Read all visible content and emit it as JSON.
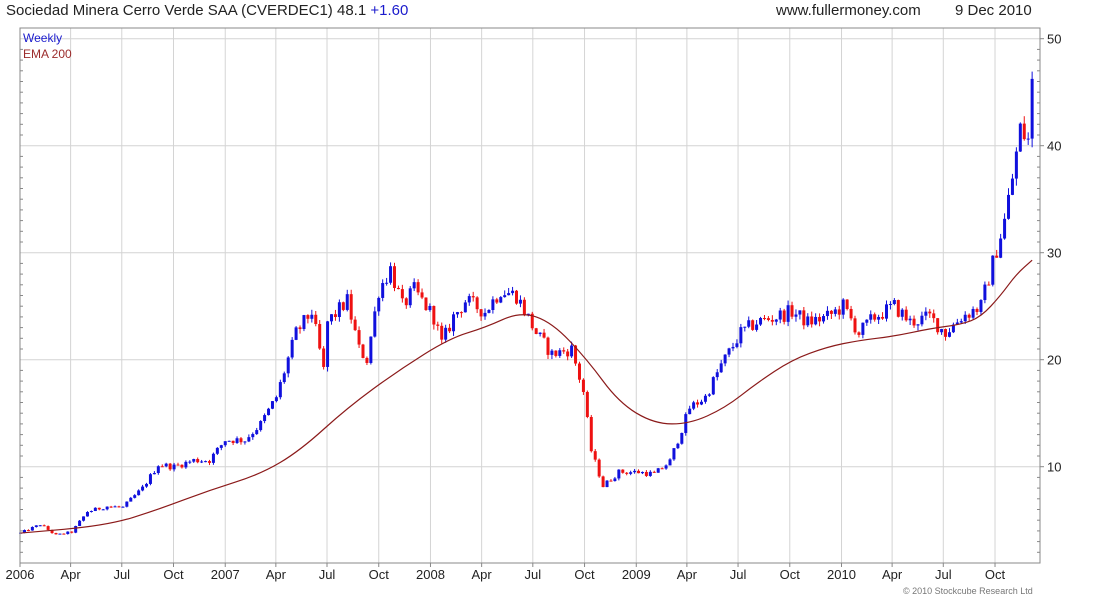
{
  "header": {
    "title": "Sociedad Minera Cerro Verde SAA (CVERDEC1) 48.1",
    "change": "+1.60",
    "site": "www.fullermoney.com",
    "date": "9 Dec 2010"
  },
  "legend": {
    "weekly": "Weekly",
    "ema": "EMA 200"
  },
  "footer": {
    "copyright": "© 2010 Stockcube Research Ltd"
  },
  "colors": {
    "up": "#1010dd",
    "down": "#ee1111",
    "ema": "#8b1a1a",
    "grid": "#d4d4d4",
    "frame": "#888888"
  },
  "chart_data": {
    "type": "candlestick",
    "title": "Sociedad Minera Cerro Verde SAA (CVERDEC1) 48.1 +1.60",
    "frequency": "Weekly",
    "ylim": [
      1,
      51
    ],
    "y_ticks": [
      10,
      20,
      30,
      40,
      50
    ],
    "x_tick_labels": [
      "2006",
      "Apr",
      "Jul",
      "Oct",
      "2007",
      "Apr",
      "Jul",
      "Oct",
      "2008",
      "Apr",
      "Jul",
      "Oct",
      "2009",
      "Apr",
      "Jul",
      "Oct",
      "2010",
      "Apr",
      "Jul",
      "Oct"
    ],
    "grid": true,
    "price_anchors": [
      [
        "2006-01-02",
        3.8
      ],
      [
        "2006-02-06",
        4.6
      ],
      [
        "2006-03-06",
        3.6
      ],
      [
        "2006-04-03",
        3.9
      ],
      [
        "2006-05-01",
        5.8
      ],
      [
        "2006-06-05",
        6.3
      ],
      [
        "2006-07-03",
        6.2
      ],
      [
        "2006-08-07",
        8.0
      ],
      [
        "2006-09-04",
        10.2
      ],
      [
        "2006-10-02",
        10.0
      ],
      [
        "2006-11-06",
        10.6
      ],
      [
        "2006-12-04",
        10.6
      ],
      [
        "2007-01-01",
        12.5
      ],
      [
        "2007-02-05",
        12.5
      ],
      [
        "2007-03-05",
        14.0
      ],
      [
        "2007-04-02",
        16.5
      ],
      [
        "2007-05-07",
        22.5
      ],
      [
        "2007-06-04",
        24.5
      ],
      [
        "2007-06-25",
        19.0
      ],
      [
        "2007-07-02",
        23.5
      ],
      [
        "2007-08-06",
        25.5
      ],
      [
        "2007-08-27",
        21.0
      ],
      [
        "2007-09-10",
        20.0
      ],
      [
        "2007-10-01",
        26.5
      ],
      [
        "2007-10-22",
        28.5
      ],
      [
        "2007-11-12",
        25.0
      ],
      [
        "2007-12-03",
        26.5
      ],
      [
        "2008-01-07",
        24.0
      ],
      [
        "2008-01-21",
        21.5
      ],
      [
        "2008-02-11",
        24.0
      ],
      [
        "2008-03-03",
        25.5
      ],
      [
        "2008-04-07",
        24.5
      ],
      [
        "2008-05-05",
        26.5
      ],
      [
        "2008-06-02",
        26.0
      ],
      [
        "2008-07-07",
        22.5
      ],
      [
        "2008-08-04",
        20.5
      ],
      [
        "2008-09-08",
        21.0
      ],
      [
        "2008-09-29",
        17.0
      ],
      [
        "2008-10-13",
        11.5
      ],
      [
        "2008-11-03",
        8.2
      ],
      [
        "2008-12-01",
        9.5
      ],
      [
        "2009-01-05",
        9.5
      ],
      [
        "2009-02-02",
        9.3
      ],
      [
        "2009-03-02",
        10.5
      ],
      [
        "2009-04-06",
        15.5
      ],
      [
        "2009-05-04",
        16.5
      ],
      [
        "2009-06-01",
        19.5
      ],
      [
        "2009-07-06",
        22.5
      ],
      [
        "2009-08-03",
        23.5
      ],
      [
        "2009-09-07",
        24.0
      ],
      [
        "2009-10-05",
        24.5
      ],
      [
        "2009-11-02",
        23.5
      ],
      [
        "2009-12-07",
        24.0
      ],
      [
        "2010-01-04",
        25.0
      ],
      [
        "2010-02-01",
        22.5
      ],
      [
        "2010-03-01",
        24.0
      ],
      [
        "2010-04-05",
        25.0
      ],
      [
        "2010-05-03",
        23.5
      ],
      [
        "2010-06-07",
        24.0
      ],
      [
        "2010-07-05",
        22.5
      ],
      [
        "2010-08-02",
        24.0
      ],
      [
        "2010-09-06",
        25.0
      ],
      [
        "2010-09-27",
        29.0
      ],
      [
        "2010-10-18",
        33.0
      ],
      [
        "2010-11-01",
        37.0
      ],
      [
        "2010-11-15",
        41.5
      ],
      [
        "2010-11-29",
        40.5
      ],
      [
        "2010-12-09",
        48.1
      ]
    ],
    "ema200": {
      "name": "EMA 200",
      "points": [
        [
          "2006-01-02",
          3.8
        ],
        [
          "2006-06-05",
          4.5
        ],
        [
          "2006-09-04",
          6.0
        ],
        [
          "2006-12-04",
          7.8
        ],
        [
          "2007-03-05",
          9.3
        ],
        [
          "2007-05-14",
          11.5
        ],
        [
          "2007-08-06",
          15.5
        ],
        [
          "2007-11-05",
          19.0
        ],
        [
          "2008-02-04",
          22.0
        ],
        [
          "2008-04-07",
          23.0
        ],
        [
          "2008-06-09",
          24.5
        ],
        [
          "2008-08-04",
          23.5
        ],
        [
          "2008-10-06",
          20.0
        ],
        [
          "2008-12-01",
          16.0
        ],
        [
          "2009-02-02",
          14.0
        ],
        [
          "2009-04-06",
          14.0
        ],
        [
          "2009-06-08",
          15.5
        ],
        [
          "2009-08-03",
          17.8
        ],
        [
          "2009-10-05",
          20.0
        ],
        [
          "2009-12-07",
          21.2
        ],
        [
          "2010-02-01",
          21.8
        ],
        [
          "2010-04-05",
          22.2
        ],
        [
          "2010-06-07",
          22.9
        ],
        [
          "2010-08-02",
          23.3
        ],
        [
          "2010-09-06",
          24.0
        ],
        [
          "2010-10-11",
          26.0
        ],
        [
          "2010-11-08",
          28.0
        ],
        [
          "2010-12-06",
          29.3
        ]
      ]
    }
  }
}
